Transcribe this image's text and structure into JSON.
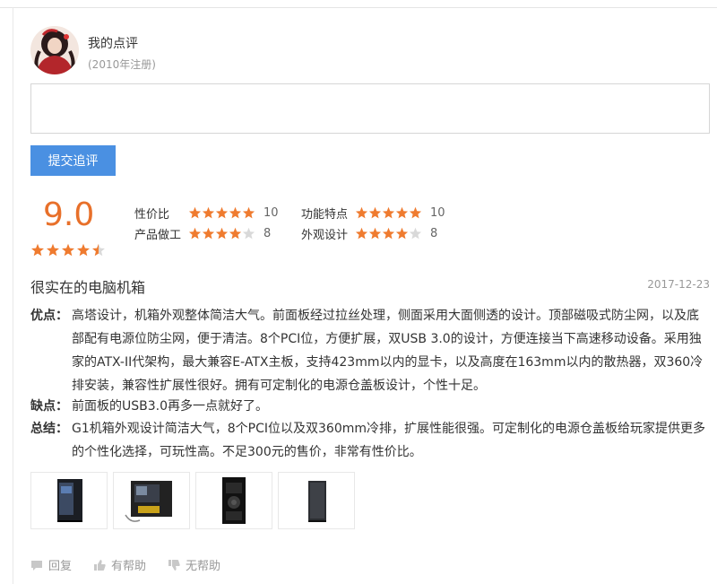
{
  "user": {
    "name": "我的点评",
    "registered": "(2010年注册)"
  },
  "reply": {
    "placeholder": "",
    "submit_label": "提交追评"
  },
  "rating": {
    "score": "9.0",
    "overall_stars": 4.5,
    "items": [
      {
        "label": "性价比",
        "stars": 5,
        "value": "10"
      },
      {
        "label": "功能特点",
        "stars": 5,
        "value": "10"
      },
      {
        "label": "产品做工",
        "stars": 4,
        "value": "8"
      },
      {
        "label": "外观设计",
        "stars": 4,
        "value": "8"
      }
    ]
  },
  "review": {
    "title": "很实在的电脑机箱",
    "date": "2017-12-23",
    "pros_label": "优点：",
    "pros": "高塔设计，机箱外观整体简洁大气。前面板经过拉丝处理，侧面采用大面侧透的设计。顶部磁吸式防尘网，以及底部配有电源位防尘网，便于清洁。8个PCI位，方便扩展，双USB 3.0的设计，方便连接当下高速移动设备。采用独家的ATX-II代架构，最大兼容E-ATX主板，支持423mm以内的显卡，以及高度在163mm以内的散热器，双360冷排安装，兼容性扩展性很好。拥有可定制化的电源仓盖板设计，个性十足。",
    "cons_label": "缺点：",
    "cons": "前面板的USB3.0再多一点就好了。",
    "summary_label": "总结：",
    "summary": "G1机箱外观设计简洁大气，8个PCI位以及双360mm冷排，扩展性能很强。可定制化的电源仓盖板给玩家提供更多的个性化选择，可玩性高。不足300元的售价，非常有性价比。"
  },
  "actions": {
    "reply": "回复",
    "helpful": "有帮助",
    "unhelpful": "无帮助"
  },
  "colors": {
    "accent": "#4a90e2",
    "score": "#e8702a",
    "star": "#ef7b2f",
    "star_empty": "#d9d9d9"
  }
}
